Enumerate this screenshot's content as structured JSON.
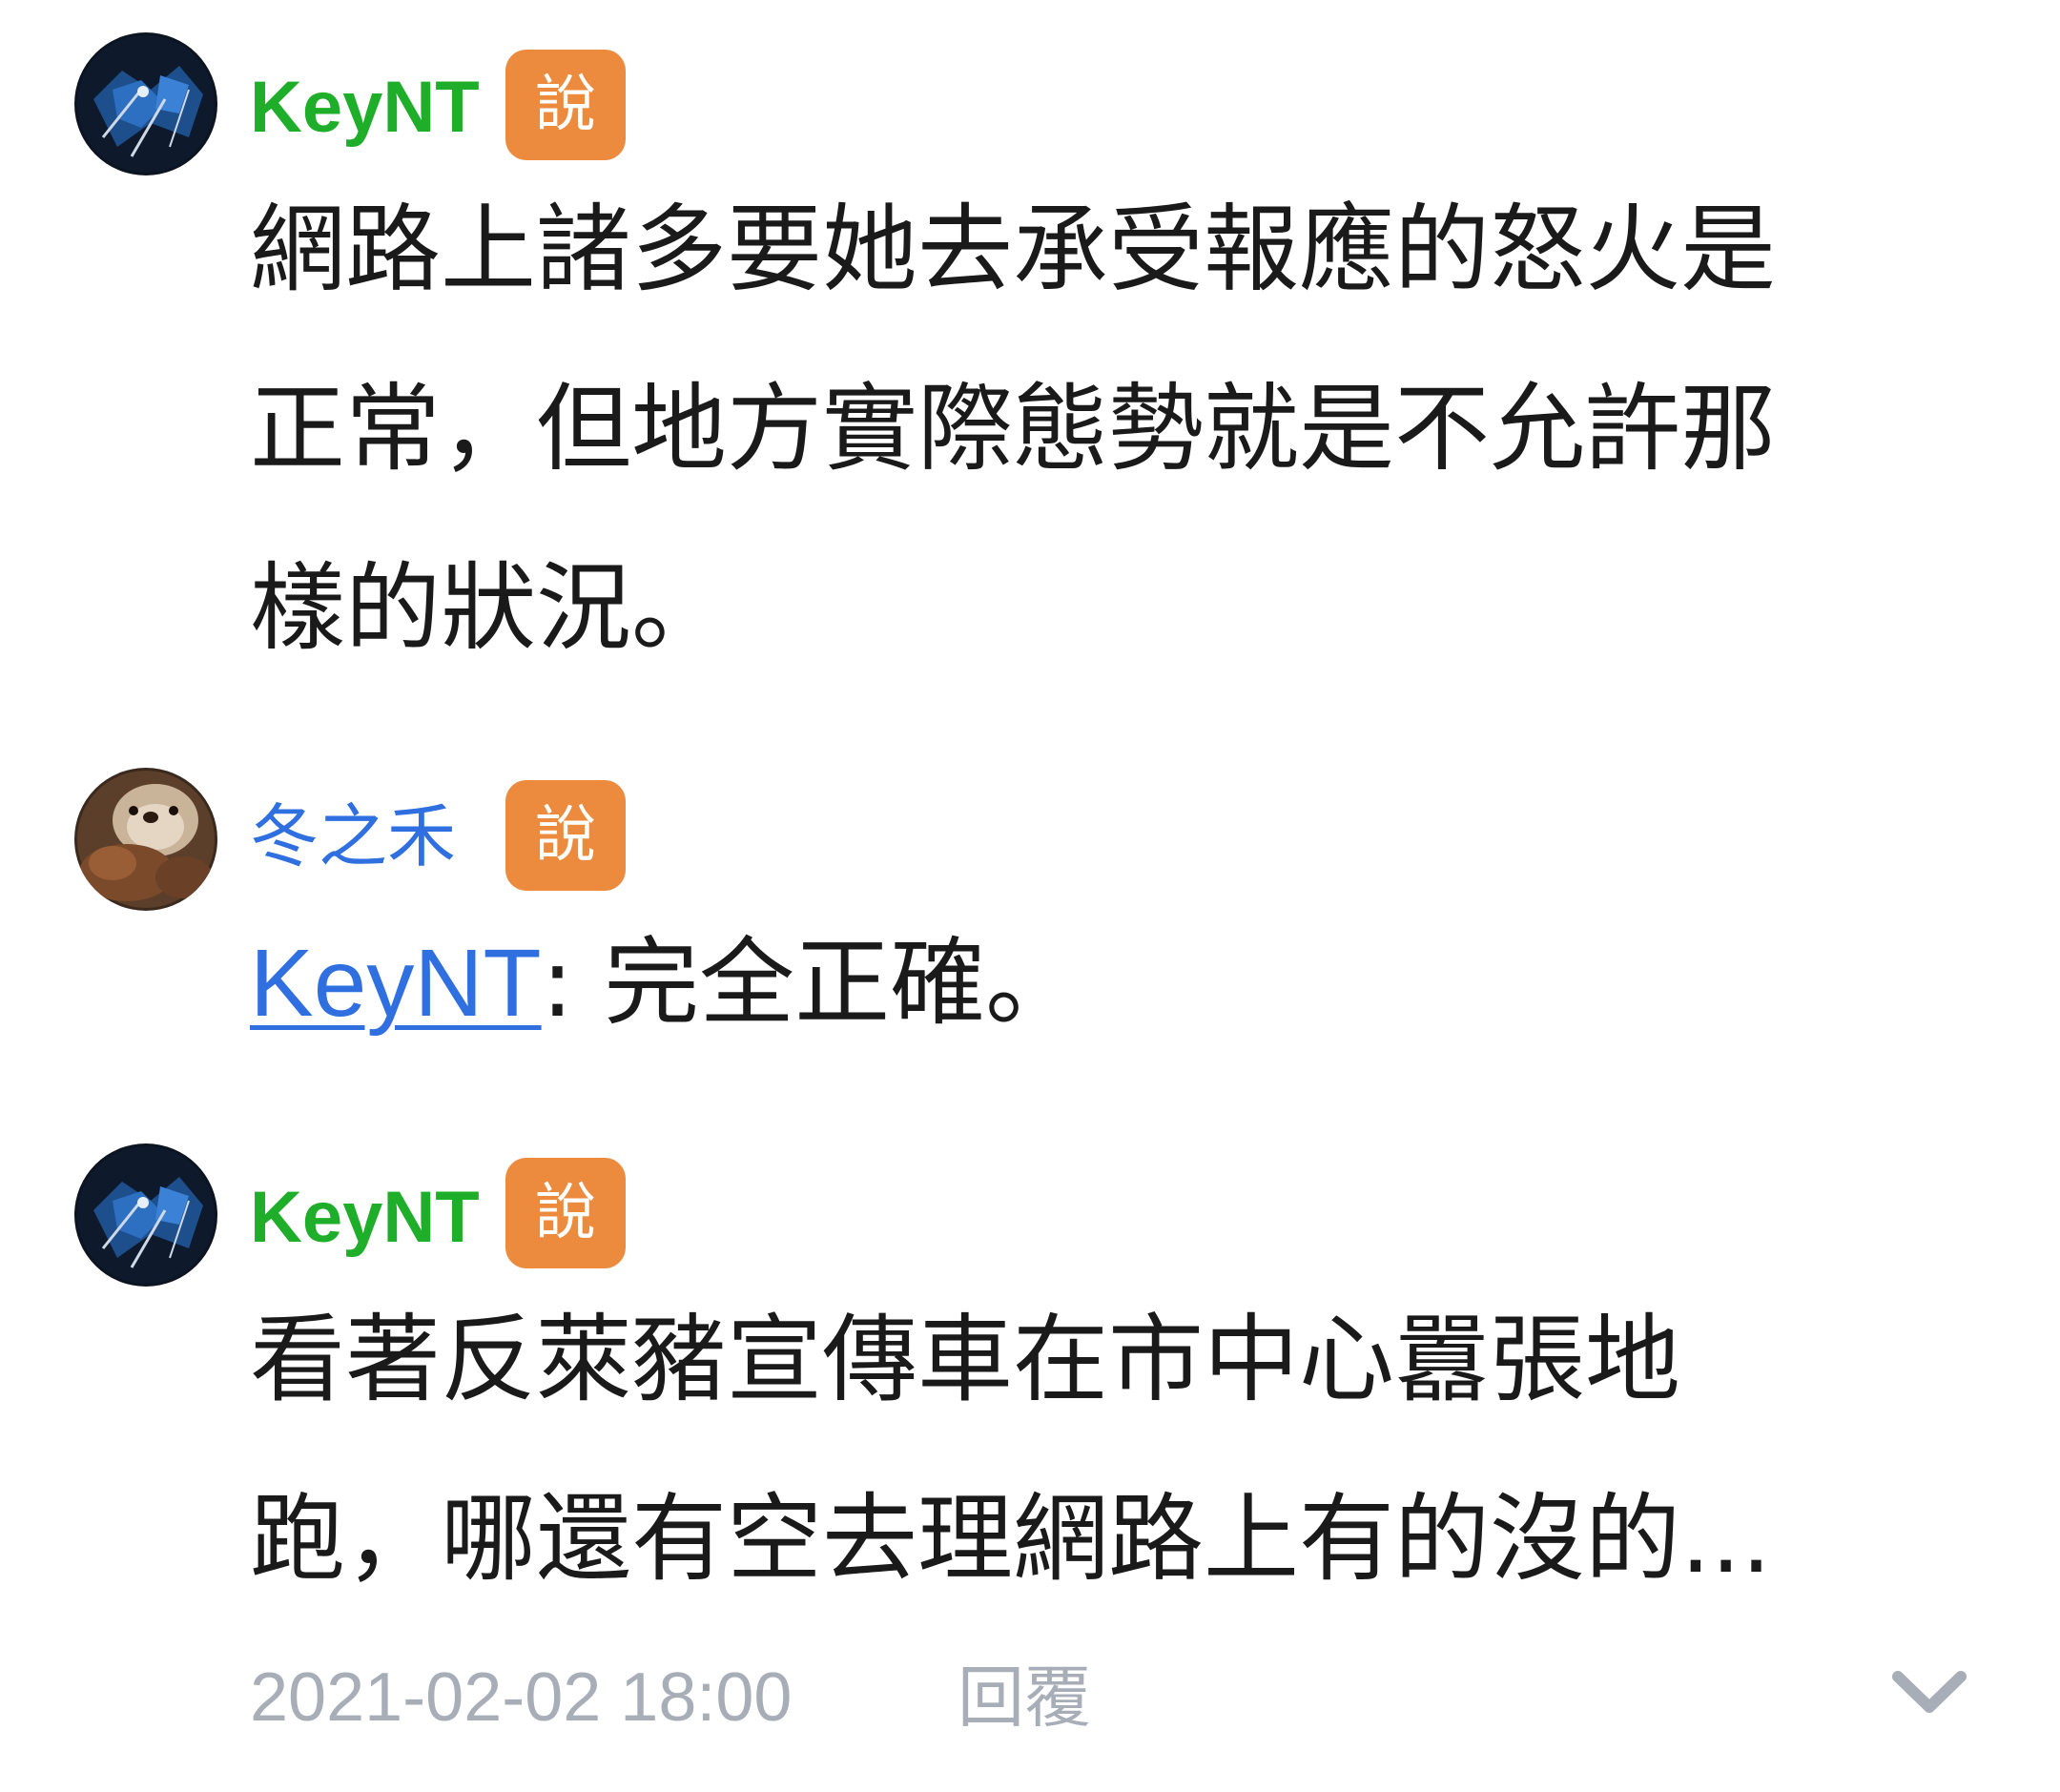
{
  "comments": [
    {
      "avatar_icon": "dark-robot-avatar",
      "author": "KeyNT",
      "author_color": "#1fae2a",
      "badge": "說",
      "lines": [
        "網路上諸多要她去承受報應的怒火是",
        "正常，但地方實際態勢就是不允許那",
        "樣的狀況。"
      ]
    },
    {
      "avatar_icon": "sea-otter-avatar",
      "author": "冬之禾",
      "author_color": "#2f6fe0",
      "badge": "說",
      "mention": "KeyNT",
      "reply_text": ": 完全正確。"
    },
    {
      "avatar_icon": "dark-robot-avatar",
      "author": "KeyNT",
      "author_color": "#1fae2a",
      "badge": "說",
      "lines": [
        "看著反萊豬宣傳車在市中心囂張地",
        "跑，哪還有空去理網路上有的沒的..."
      ]
    }
  ],
  "footer": {
    "timestamp": "2021-02-02 18:00",
    "reply_label": "回覆",
    "expand_icon": "chevron-down-icon"
  },
  "colors": {
    "badge_bg": "#ec8a3d",
    "meta_gray": "#a8aeb8",
    "link_blue": "#2f6fe0"
  }
}
